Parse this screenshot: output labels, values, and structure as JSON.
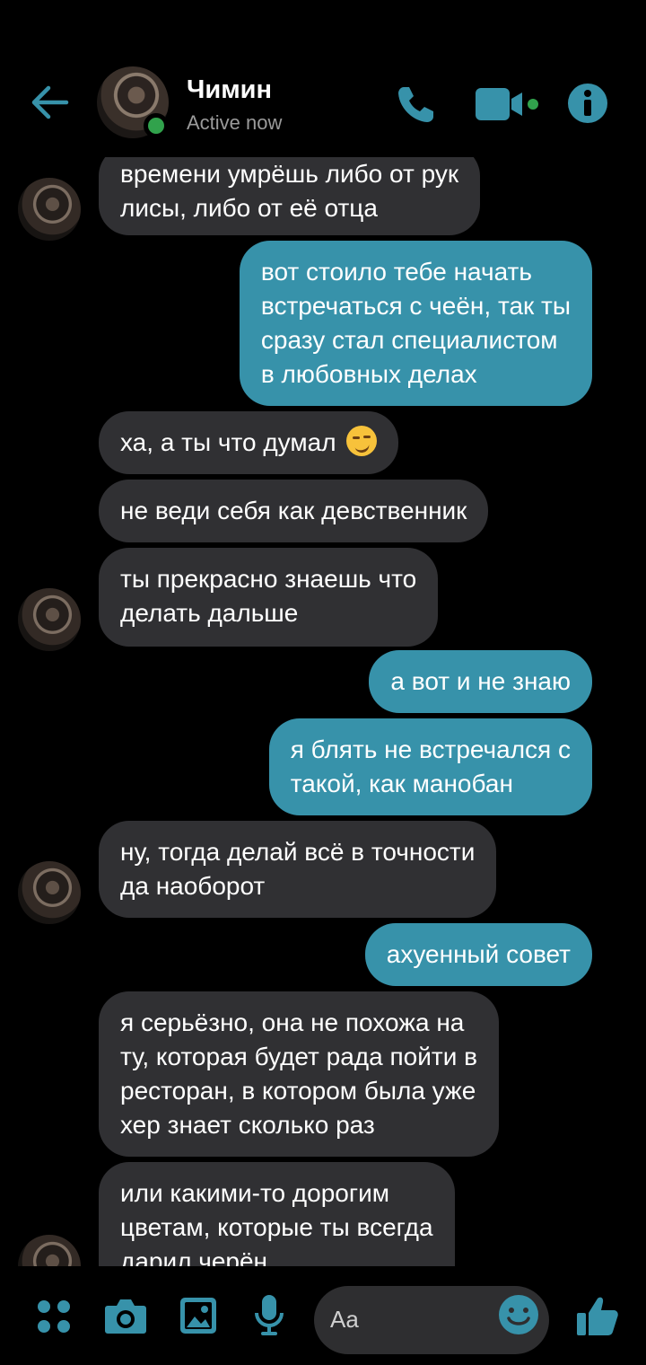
{
  "header": {
    "contact_name": "Чимин",
    "status": "Active now",
    "accent_color": "#3792aa",
    "online_color": "#31a24c",
    "icons": [
      "back-arrow-icon",
      "phone-icon",
      "video-camera-icon",
      "info-icon"
    ]
  },
  "messages": [
    {
      "side": "in",
      "lines": [
        "времени умрёшь либо от рук",
        "лисы, либо от её отца"
      ]
    },
    {
      "side": "out",
      "lines": [
        "вот стоило тебе начать",
        "встречаться с чеён, так ты",
        "сразу стал специалистом",
        "в любовных делах"
      ]
    },
    {
      "side": "in",
      "lines": [
        "ха, а ты что думал"
      ],
      "emoji": "smirk-emoji"
    },
    {
      "side": "in",
      "lines": [
        "не веди себя как девственник"
      ]
    },
    {
      "side": "in",
      "lines": [
        "ты прекрасно знаешь что",
        "делать дальше"
      ]
    },
    {
      "side": "out",
      "lines": [
        "а вот и не знаю"
      ]
    },
    {
      "side": "out",
      "lines": [
        "я блять не встречался с",
        "такой, как манобан"
      ]
    },
    {
      "side": "in",
      "lines": [
        "ну, тогда делай всё в точности",
        "да наоборот"
      ]
    },
    {
      "side": "out",
      "lines": [
        "ахуенный совет"
      ]
    },
    {
      "side": "in",
      "lines": [
        "я серьёзно, она не похожа на",
        "ту, которая будет рада пойти в",
        "ресторан, в котором была уже",
        "хер знает сколько раз"
      ]
    },
    {
      "side": "in",
      "lines": [
        "или какими-то дорогим",
        "цветам, которые ты всегда",
        "дарил черён"
      ]
    }
  ],
  "composer": {
    "placeholder": "Aa",
    "icons": [
      "apps-icon",
      "camera-icon",
      "gallery-icon",
      "microphone-icon",
      "emoji-icon",
      "thumbs-up-icon"
    ]
  }
}
